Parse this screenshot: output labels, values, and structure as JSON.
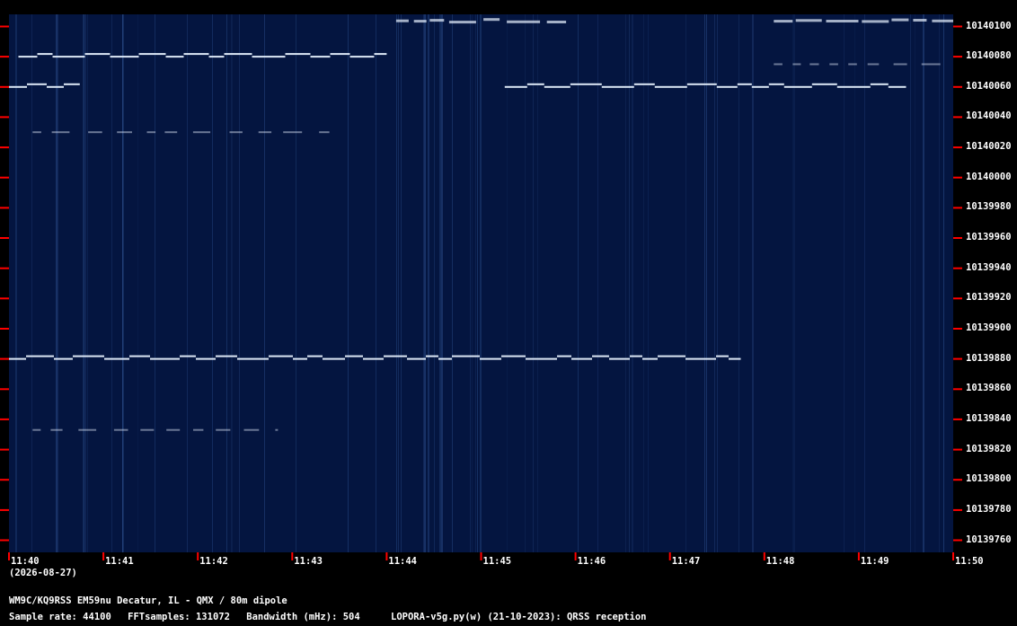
{
  "chart_data": {
    "type": "heatmap",
    "y_axis": {
      "ticks": [
        10140100,
        10140080,
        10140060,
        10140040,
        10140020,
        10140000,
        10139980,
        10139960,
        10139940,
        10139920,
        10139900,
        10139880,
        10139860,
        10139840,
        10139820,
        10139800,
        10139780,
        10139760
      ],
      "range": [
        10139752,
        10140108
      ],
      "label_side": "right"
    },
    "x_axis": {
      "ticks": [
        "11:40",
        "11:41",
        "11:42",
        "11:43",
        "11:44",
        "11:45",
        "11:46",
        "11:47",
        "11:48",
        "11:49",
        "11:50"
      ],
      "range_minutes": [
        0,
        10
      ]
    },
    "signals": [
      {
        "freq": 10139880,
        "start_min": 0.0,
        "end_min": 7.75,
        "kind": "fsk"
      },
      {
        "freq": 10140060,
        "start_min": 0.0,
        "end_min": 0.75,
        "kind": "fsk"
      },
      {
        "freq": 10140060,
        "start_min": 5.25,
        "end_min": 9.5,
        "kind": "fsk"
      },
      {
        "freq": 10140080,
        "start_min": 0.1,
        "end_min": 4.0,
        "kind": "fsk"
      },
      {
        "freq": 10140030,
        "start_min": 0.25,
        "end_min": 3.5,
        "kind": "faint"
      },
      {
        "freq": 10139833,
        "start_min": 0.25,
        "end_min": 2.85,
        "kind": "faint"
      },
      {
        "freq": 10140104,
        "start_min": 4.1,
        "end_min": 5.9,
        "kind": "noisy"
      },
      {
        "freq": 10140104,
        "start_min": 8.1,
        "end_min": 10.0,
        "kind": "noisy"
      },
      {
        "freq": 10140075,
        "start_min": 8.1,
        "end_min": 10.0,
        "kind": "faint"
      }
    ],
    "colors": {
      "background": "#041540",
      "signal": "#e8f2ff",
      "tick": "#ff0000",
      "streak": "#3b63a8"
    }
  },
  "date_text": "(2026-08-27)",
  "footer": {
    "station": "WM9C/KQ9RSS EM59nu Decatur, IL - QMX / 80m dipole",
    "sample_rate": "Sample rate: 44100",
    "fft_samples": "FFTsamples: 131072",
    "bandwidth": "Bandwidth (mHz): 504",
    "software": "LOPORA-v5g.py(w) (21-10-2023): QRSS reception"
  }
}
